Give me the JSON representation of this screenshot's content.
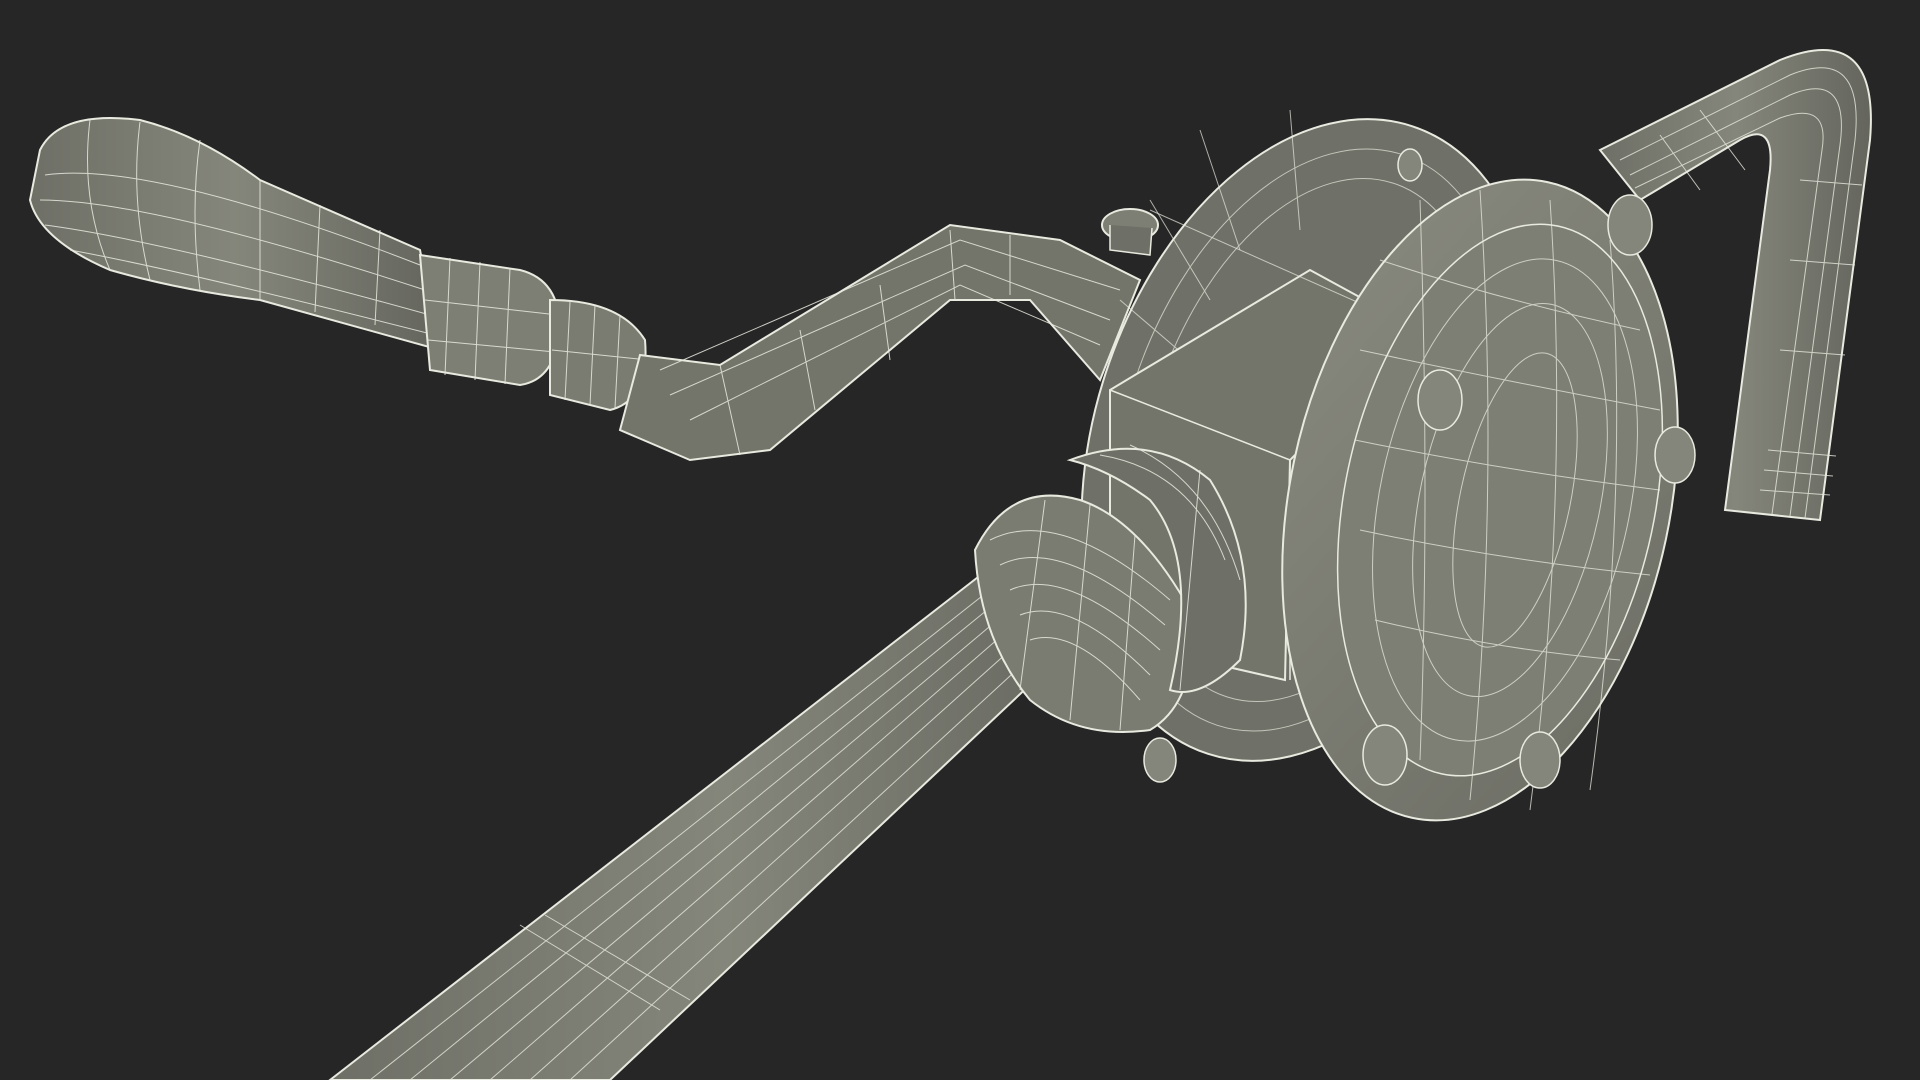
{
  "scene": {
    "background_color": "#262626",
    "model_color": "#7a7b71",
    "model_shadow_color": "#5f6058",
    "wire_color": "#e8eadf",
    "render_style": "wireframe-over-shaded",
    "subject_parts": [
      "crank-handle-grip",
      "crank-arm",
      "pump-housing",
      "front-cover-plate",
      "cover-bolts",
      "inlet-pipe",
      "pipe-coupling-nut",
      "curved-spout"
    ]
  }
}
